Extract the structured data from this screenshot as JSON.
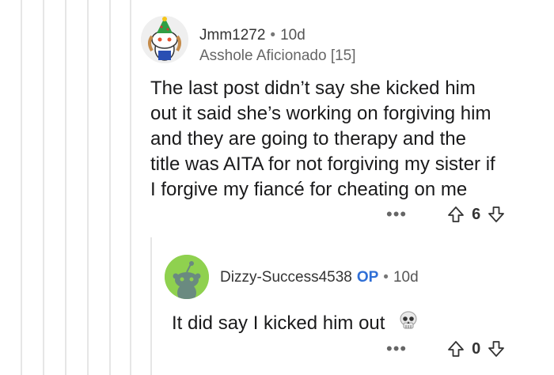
{
  "comment1": {
    "author": "Jmm1272",
    "separator": "•",
    "time": "10d",
    "flair": "Asshole Aficionado [15]",
    "body_lines": [
      "The last post didn’t say she kicked him",
      "out it said she’s working on forgiving him",
      "and they are going to therapy and the",
      "title was AITA for not forgiving my sister if",
      "I forgive my fiancé for cheating on me"
    ],
    "more": "•••",
    "score": "6"
  },
  "comment2": {
    "author": "Dizzy-Success4538",
    "op_badge": "OP",
    "separator": "•",
    "time": "10d",
    "body": "It did say I kicked him out",
    "emoji": "💀",
    "more": "•••",
    "score": "0"
  },
  "colors": {
    "op": "#2f6fd6",
    "avatar2_bg": "#8fd14f",
    "thread": "#e6e6e6"
  },
  "icons": [
    "upvote-icon",
    "downvote-icon",
    "skull-emoji"
  ]
}
